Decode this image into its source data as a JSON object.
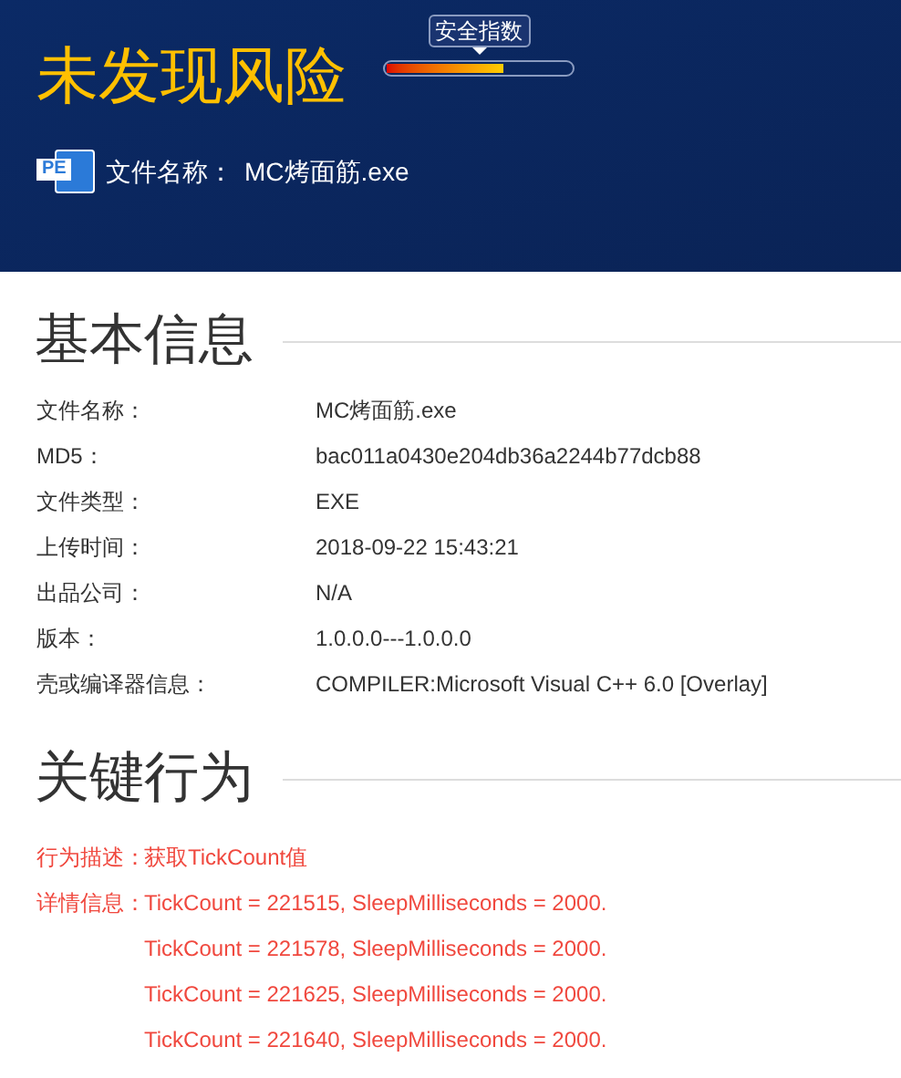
{
  "header": {
    "verdict": "未发现风险",
    "meter": {
      "label": "安全指数",
      "level": 0.63
    },
    "file_label": "文件名称：",
    "file_name": "MC烤面筋.exe",
    "file_icon_text": "PE"
  },
  "basic_info": {
    "title": "基本信息",
    "rows": [
      {
        "label": "文件名称：",
        "value": "MC烤面筋.exe"
      },
      {
        "label": "MD5：",
        "value": "bac011a0430e204db36a2244b77dcb88"
      },
      {
        "label": "文件类型：",
        "value": "EXE"
      },
      {
        "label": "上传时间：",
        "value": "2018-09-22 15:43:21"
      },
      {
        "label": "出品公司：",
        "value": "N/A"
      },
      {
        "label": "版本：",
        "value": "1.0.0.0---1.0.0.0"
      },
      {
        "label": "壳或编译器信息：",
        "value": "COMPILER:Microsoft Visual C++ 6.0 [Overlay]"
      }
    ]
  },
  "key_behavior": {
    "title": "关键行为",
    "description_label": "行为描述：",
    "description": "获取TickCount值",
    "details_label": "详情信息：",
    "details": [
      "TickCount = 221515, SleepMilliseconds = 2000.",
      "TickCount = 221578, SleepMilliseconds = 2000.",
      "TickCount = 221625, SleepMilliseconds = 2000.",
      "TickCount = 221640, SleepMilliseconds = 2000."
    ]
  }
}
